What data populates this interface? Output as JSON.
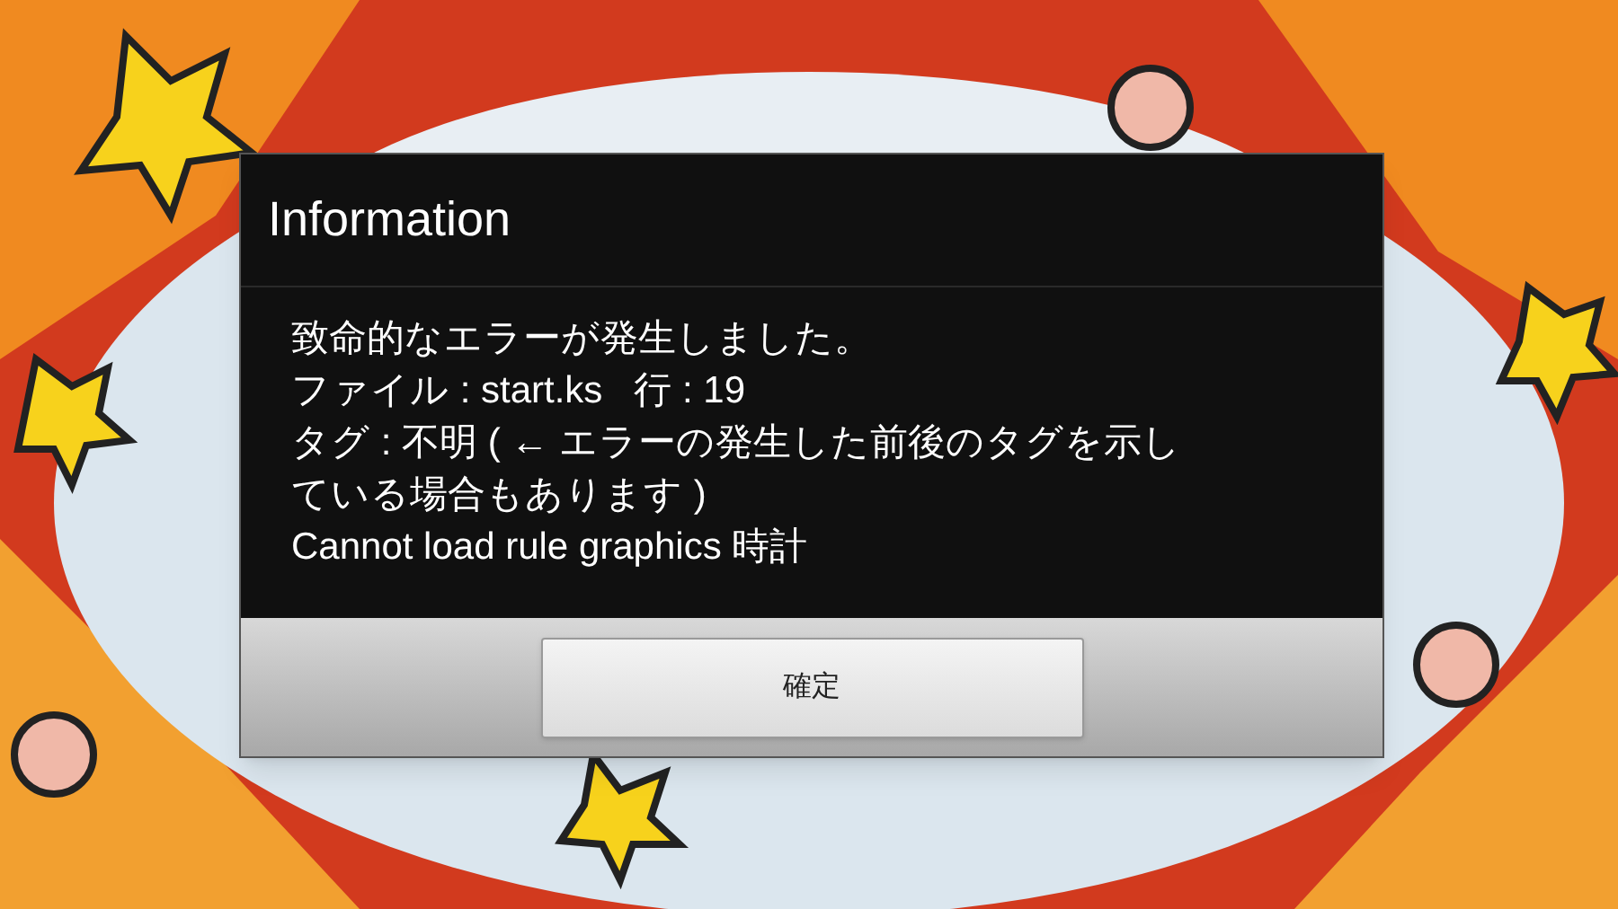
{
  "dialog": {
    "title": "Information",
    "message_lines": [
      "致命的なエラーが発生しました。",
      "ファイル : start.ks   行 : 19",
      "タグ : 不明 ( ← エラーの発生した前後のタグを示し",
      "ている場合もあります )",
      "Cannot load rule graphics 時計"
    ],
    "buttons": [
      "確定"
    ]
  }
}
